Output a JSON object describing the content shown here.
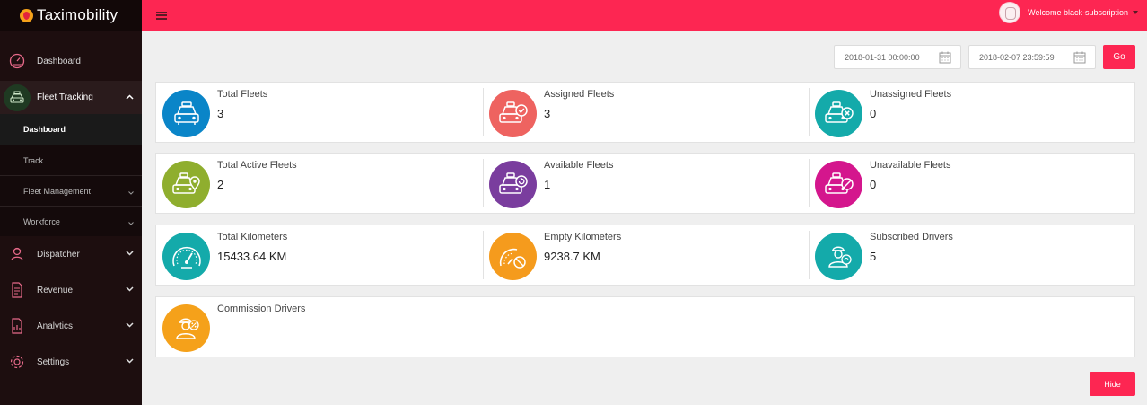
{
  "app": {
    "name": "Taximobility"
  },
  "sidebar": {
    "items": [
      {
        "label": "Dashboard"
      },
      {
        "label": "Fleet Tracking",
        "sub": [
          {
            "label": "Dashboard"
          },
          {
            "label": "Track"
          },
          {
            "label": "Fleet Management"
          },
          {
            "label": "Workforce"
          }
        ]
      },
      {
        "label": "Dispatcher"
      },
      {
        "label": "Revenue"
      },
      {
        "label": "Analytics"
      },
      {
        "label": "Settings"
      }
    ]
  },
  "header": {
    "welcome": "Welcome black-subscription"
  },
  "filter": {
    "start": "2018-01-31 00:00:00",
    "end": "2018-02-07 23:59:59",
    "go_label": "Go"
  },
  "stats": [
    {
      "label": "Total Fleets",
      "value": "3",
      "color": "#0a85c8",
      "icon": "taxi-icon"
    },
    {
      "label": "Assigned Fleets",
      "value": "3",
      "color": "#ee6360",
      "icon": "taxi-check-icon"
    },
    {
      "label": "Unassigned Fleets",
      "value": "0",
      "color": "#14aaaa",
      "icon": "taxi-cross-icon"
    },
    {
      "label": "Total Active Fleets",
      "value": "2",
      "color": "#8fae2e",
      "icon": "taxi-location-icon"
    },
    {
      "label": "Available Fleets",
      "value": "1",
      "color": "#7a3d9e",
      "icon": "taxi-refresh-icon"
    },
    {
      "label": "Unavailable Fleets",
      "value": "0",
      "color": "#d4168d",
      "icon": "taxi-block-icon"
    },
    {
      "label": "Total Kilometers",
      "value": "15433.64 KM",
      "color": "#14aaaa",
      "icon": "speedometer-icon"
    },
    {
      "label": "Empty Kilometers",
      "value": "9238.7 KM",
      "color": "#f59b1d",
      "icon": "speedometer-block-icon"
    },
    {
      "label": "Subscribed Drivers",
      "value": "5",
      "color": "#14aaaa",
      "icon": "driver-subscribed-icon"
    },
    {
      "label": "Commission Drivers",
      "value": "",
      "color": "#f5a11a",
      "icon": "driver-commission-icon"
    }
  ],
  "footer": {
    "hide_label": "Hide"
  }
}
